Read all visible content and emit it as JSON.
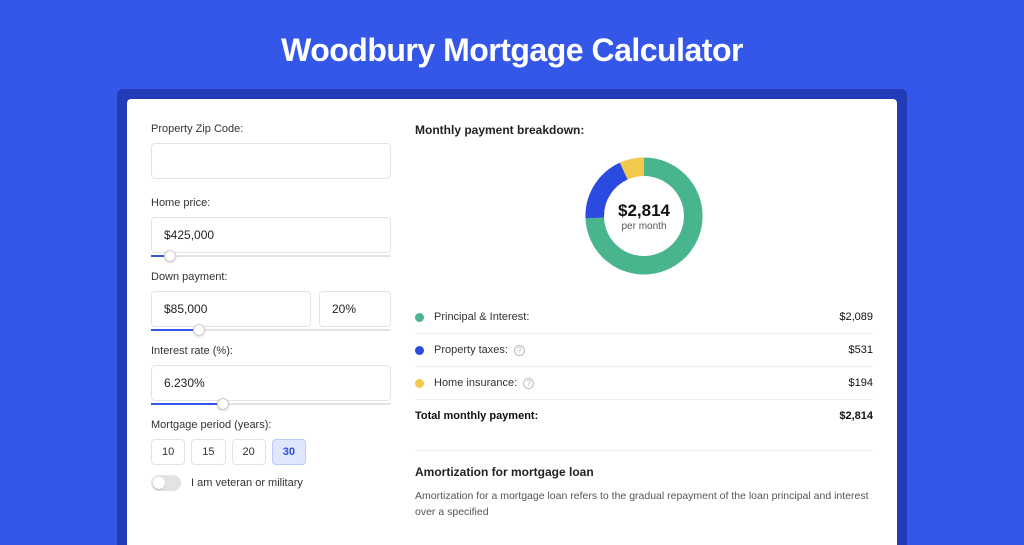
{
  "title": "Woodbury Mortgage Calculator",
  "form": {
    "zip_label": "Property Zip Code:",
    "zip_value": "",
    "home_price_label": "Home price:",
    "home_price_value": "$425,000",
    "home_price_slider_pct": 8,
    "down_payment_label": "Down payment:",
    "down_payment_value": "$85,000",
    "down_payment_pct_value": "20%",
    "down_payment_slider_pct": 20,
    "interest_label": "Interest rate (%):",
    "interest_value": "6.230%",
    "interest_slider_pct": 30,
    "period_label": "Mortgage period (years):",
    "periods": [
      "10",
      "15",
      "20",
      "30"
    ],
    "period_active_index": 3,
    "veteran_label": "I am veteran or military"
  },
  "breakdown": {
    "heading": "Monthly payment breakdown:",
    "center_amount": "$2,814",
    "center_sub": "per month",
    "legend": [
      {
        "label": "Principal & Interest:",
        "value": "$2,089",
        "color": "#49b58d",
        "info": false
      },
      {
        "label": "Property taxes:",
        "value": "$531",
        "color": "#2b4be0",
        "info": true
      },
      {
        "label": "Home insurance:",
        "value": "$194",
        "color": "#f2c94c",
        "info": true
      }
    ],
    "total_label": "Total monthly payment:",
    "total_value": "$2,814"
  },
  "amort": {
    "heading": "Amortization for mortgage loan",
    "body": "Amortization for a mortgage loan refers to the gradual repayment of the loan principal and interest over a specified"
  },
  "chart_data": {
    "type": "pie",
    "title": "Monthly payment breakdown",
    "series": [
      {
        "name": "Principal & Interest",
        "value": 2089,
        "color": "#49b58d"
      },
      {
        "name": "Property taxes",
        "value": 531,
        "color": "#2b4be0"
      },
      {
        "name": "Home insurance",
        "value": 194,
        "color": "#f2c94c"
      }
    ],
    "total": 2814,
    "unit": "USD per month"
  }
}
